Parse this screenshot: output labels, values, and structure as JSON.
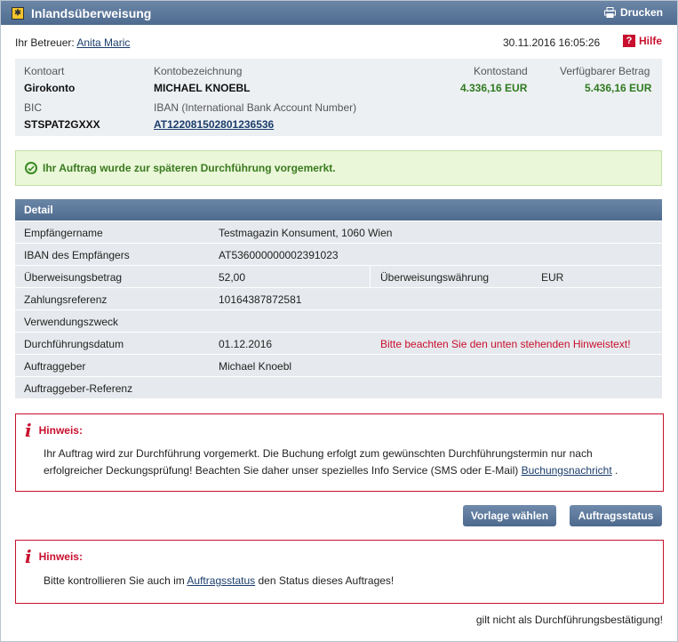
{
  "header": {
    "title": "Inlandsüberweisung",
    "print_label": "Drucken"
  },
  "meta": {
    "betreuer_label": "Ihr Betreuer:",
    "betreuer_name": "Anita Maric",
    "datetime": "30.11.2016 16:05:26",
    "help_label": "Hilfe"
  },
  "account": {
    "kontoart_label": "Kontoart",
    "kontoart_value": "Girokonto",
    "bezeichnung_label": "Kontobezeichnung",
    "bezeichnung_value": "MICHAEL KNOEBL",
    "kontostand_label": "Kontostand",
    "kontostand_value": "4.336,16 EUR",
    "verfuegbar_label": "Verfügbarer Betrag",
    "verfuegbar_value": "5.436,16 EUR",
    "bic_label": "BIC",
    "bic_value": "STSPAT2GXXX",
    "iban_label": "IBAN (International Bank Account Number)",
    "iban_value": "AT122081502801236536"
  },
  "success_message": "Ihr Auftrag wurde zur späteren Durchführung vorgemerkt.",
  "detail": {
    "heading": "Detail",
    "rows": [
      {
        "label": "Empfängername",
        "value": "Testmagazin Konsument, 1060 Wien"
      },
      {
        "label": "IBAN des Empfängers",
        "value": "AT536000000002391023"
      },
      {
        "label": "Überweisungsbetrag",
        "value": "52,00",
        "label2": "Überweisungswährung",
        "value2": "EUR"
      },
      {
        "label": "Zahlungsreferenz",
        "value": "10164387872581"
      },
      {
        "label": "Verwendungszweck",
        "value": ""
      },
      {
        "label": "Durchführungsdatum",
        "value": "01.12.2016",
        "warning": "Bitte beachten Sie den unten stehenden Hinweistext!"
      },
      {
        "label": "Auftraggeber",
        "value": "Michael Knoebl"
      },
      {
        "label": "Auftraggeber-Referenz",
        "value": ""
      }
    ]
  },
  "notice1": {
    "heading": "Hinweis:",
    "text_line1": "Ihr Auftrag wird zur Durchführung vorgemerkt. Die Buchung erfolgt zum gewünschten Durchführungstermin nur nach",
    "text_line2": "erfolgreicher Deckungsprüfung! Beachten Sie daher unser spezielles Info Service (SMS oder E-Mail)",
    "link": "Buchungsnachricht",
    "text_end": "."
  },
  "buttons": {
    "template": "Vorlage wählen",
    "status": "Auftragsstatus"
  },
  "notice2": {
    "heading": "Hinweis:",
    "text_before": "Bitte kontrollieren Sie auch im",
    "link": "Auftragsstatus",
    "text_after": "den Status dieses Auftrages!"
  },
  "footer_note": "gilt nicht als Durchführungsbestätigung!"
}
